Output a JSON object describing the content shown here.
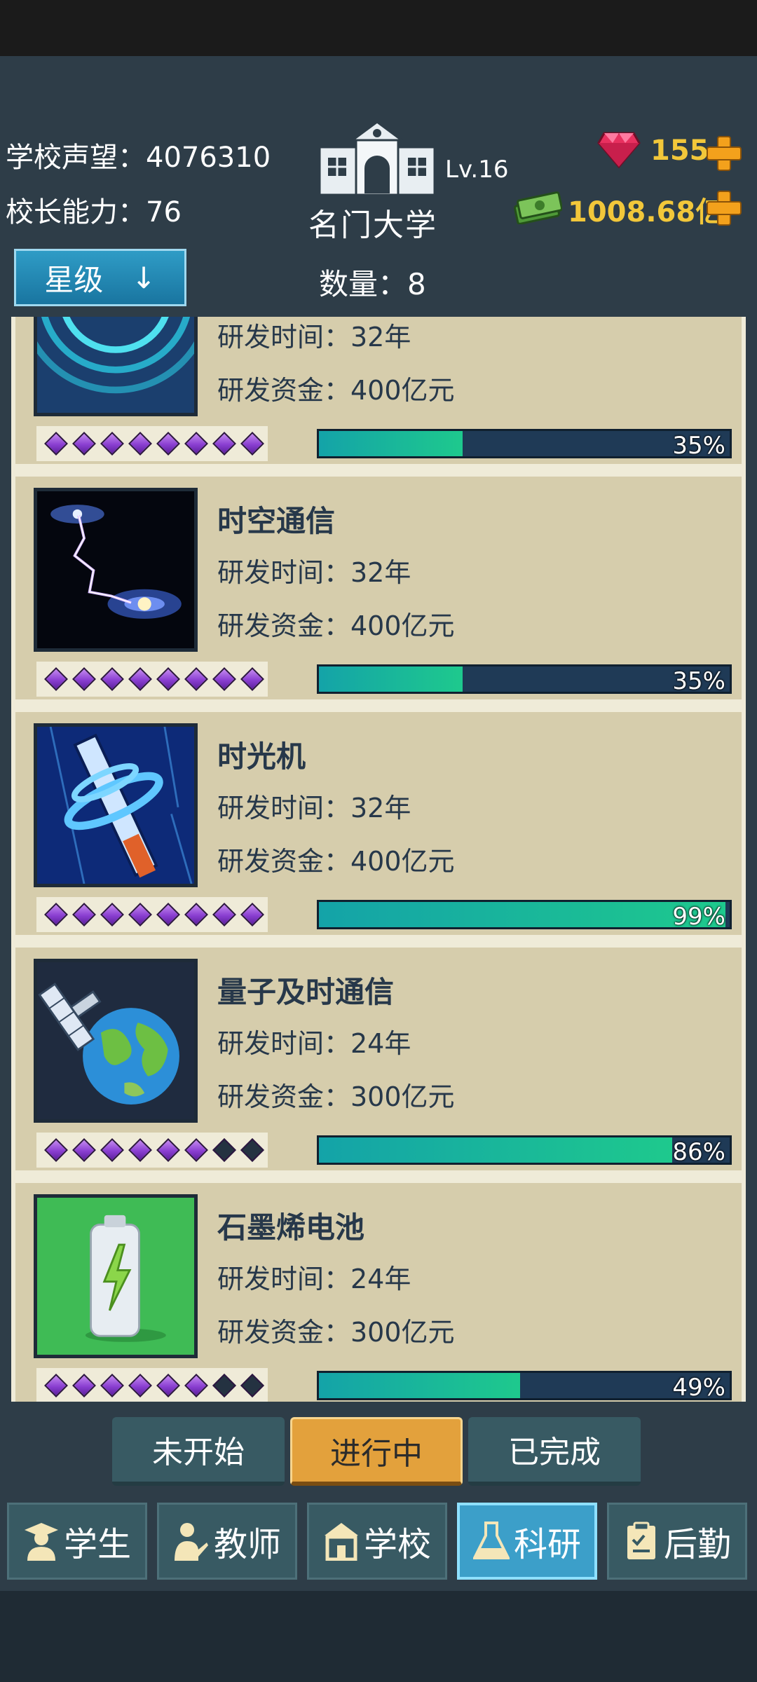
{
  "header": {
    "reputation_label": "学校声望：4076310",
    "ability_label": "校长能力：76",
    "school_name": "名门大学",
    "school_level": "Lv.16",
    "gems": "155",
    "money": "1008.68亿"
  },
  "toolbar": {
    "sort_label": "星级",
    "sort_arrow": "↓",
    "count_label": "数量：",
    "count_value": "8"
  },
  "research_items": [
    {
      "name": "",
      "time": "研发时间：32年",
      "fund": "研发资金：400亿元",
      "stars_on": 8,
      "stars_total": 8,
      "progress": 0.35,
      "progress_label": "35%",
      "icon": "earth-signal-icon"
    },
    {
      "name": "时空通信",
      "time": "研发时间：32年",
      "fund": "研发资金：400亿元",
      "stars_on": 8,
      "stars_total": 8,
      "progress": 0.35,
      "progress_label": "35%",
      "icon": "galaxy-lightning-icon"
    },
    {
      "name": "时光机",
      "time": "研发时间：32年",
      "fund": "研发资金：400亿元",
      "stars_on": 8,
      "stars_total": 8,
      "progress": 0.99,
      "progress_label": "99%",
      "icon": "time-machine-icon"
    },
    {
      "name": "量子及时通信",
      "time": "研发时间：24年",
      "fund": "研发资金：300亿元",
      "stars_on": 6,
      "stars_total": 8,
      "progress": 0.86,
      "progress_label": "86%",
      "icon": "satellite-earth-icon"
    },
    {
      "name": "石墨烯电池",
      "time": "研发时间：24年",
      "fund": "研发资金：300亿元",
      "stars_on": 6,
      "stars_total": 8,
      "progress": 0.49,
      "progress_label": "49%",
      "icon": "battery-icon"
    }
  ],
  "filters": [
    {
      "label": "未开始",
      "active": false
    },
    {
      "label": "进行中",
      "active": true
    },
    {
      "label": "已完成",
      "active": false
    }
  ],
  "tabs": [
    {
      "label": "学生",
      "icon": "student-icon",
      "active": false
    },
    {
      "label": "教师",
      "icon": "teacher-icon",
      "active": false
    },
    {
      "label": "学校",
      "icon": "school-icon",
      "active": false
    },
    {
      "label": "科研",
      "icon": "flask-icon",
      "active": true
    },
    {
      "label": "后勤",
      "icon": "clipboard-icon",
      "active": false
    }
  ],
  "colors": {
    "background": "#2e3d48",
    "card": "#d6cdac",
    "gold_text": "#f2c73a",
    "active_filter": "#e3a13c",
    "active_tab": "#3c9fc9",
    "progress_fill": "#1ec98d",
    "progress_track": "#1f3a56",
    "star_on": "#8a3fd1"
  }
}
